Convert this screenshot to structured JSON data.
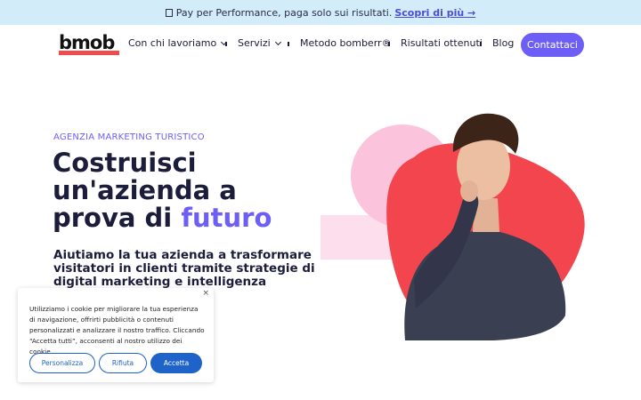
{
  "banner": {
    "icon": "tag-icon",
    "text": "Pay per Performance, paga solo sui risultati.",
    "link_label": "Scopri di più →"
  },
  "nav": {
    "logo_text": "bmob",
    "items": [
      {
        "label": "Con chi lavoriamo",
        "has_dropdown": true
      },
      {
        "label": "Servizi",
        "has_dropdown": true
      },
      {
        "label": "Metodo bomberr®",
        "has_dropdown": false
      },
      {
        "label": "Risultati ottenuti",
        "has_dropdown": false
      },
      {
        "label": "Blog",
        "has_dropdown": false
      }
    ],
    "cta_label": "Contattaci"
  },
  "hero": {
    "eyebrow": "AGENZIA MARKETING TURISTICO",
    "title_main": "Costruisci un'azienda a prova di",
    "title_accent": "futuro",
    "subtitle": "Aiutiamo la tua azienda a trasformare visitatori in clienti tramite strategie di digital marketing e intelligenza artificiale."
  },
  "cookie_banner": {
    "close_label": "×",
    "text": "Utilizziamo i cookie per migliorare la tua esperienza di navigazione, offrirti pubblicità o contenuti personalizzati e analizzare il nostro traffico. Cliccando “Accetta tutti”, acconsenti al nostro utilizzo dei cookie.",
    "customize_label": "Personalizza",
    "reject_label": "Rifiuta",
    "accept_label": "Accetta"
  },
  "colors": {
    "accent": "#6d5ff5",
    "banner_bg": "#d3ecfa",
    "logo_red": "#ef4c4c",
    "blob_red": "#f2454d",
    "blob_pink": "#fbc3dc",
    "cookie_blue": "#1d63c9"
  }
}
